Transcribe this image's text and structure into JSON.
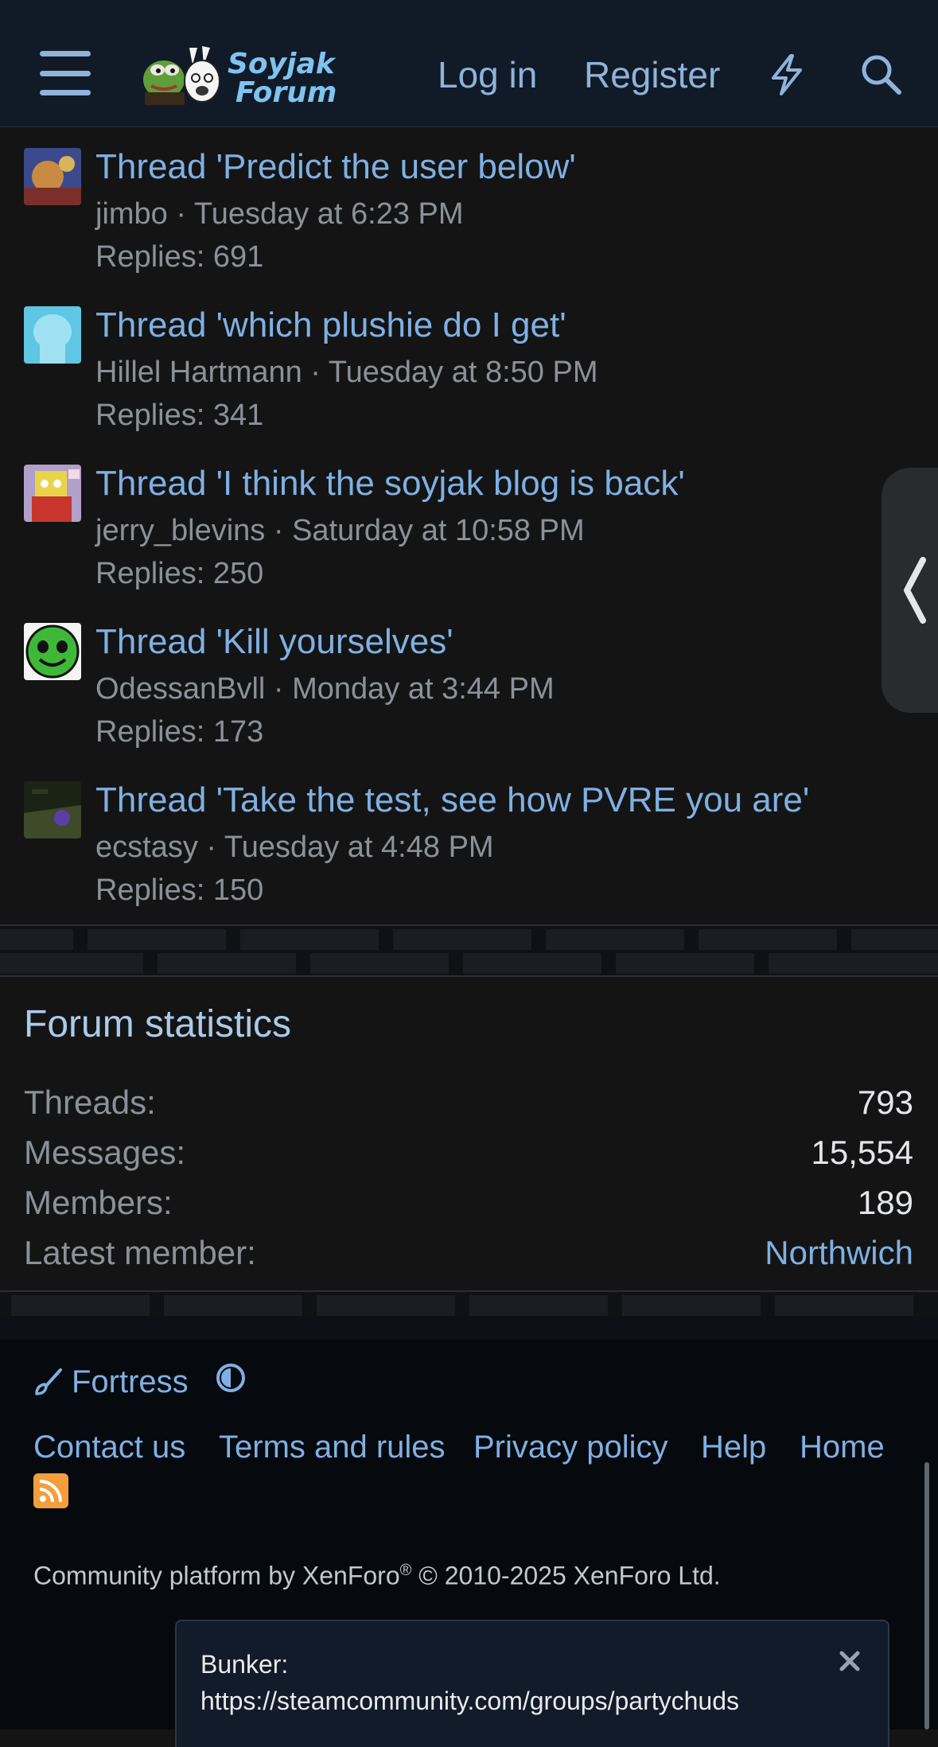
{
  "header": {
    "logo_text": "Soyjak Forum",
    "login_label": "Log in",
    "register_label": "Register"
  },
  "threads": [
    {
      "title": "Thread 'Predict the user below'",
      "meta": "jimbo · Tuesday at 6:23 PM",
      "replies": "Replies: 691"
    },
    {
      "title": "Thread 'which plushie do I get'",
      "meta": "Hillel Hartmann · Tuesday at 8:50 PM",
      "replies": "Replies: 341"
    },
    {
      "title": "Thread 'I think the soyjak blog is back'",
      "meta": "jerry_blevins · Saturday at 10:58 PM",
      "replies": "Replies: 250"
    },
    {
      "title": "Thread 'Kill yourselves'",
      "meta": "OdessanBvll · Monday at 3:44 PM",
      "replies": "Replies: 173"
    },
    {
      "title": "Thread 'Take the test, see how PVRE you are'",
      "meta": "ecstasy · Tuesday at 4:48 PM",
      "replies": "Replies: 150"
    }
  ],
  "stats": {
    "title": "Forum statistics",
    "rows": [
      {
        "label": "Threads:",
        "value": "793"
      },
      {
        "label": "Messages:",
        "value": "15,554"
      },
      {
        "label": "Members:",
        "value": "189"
      },
      {
        "label": "Latest member:",
        "value": "Northwich"
      }
    ]
  },
  "footer": {
    "style_label": "Fortress",
    "links": [
      "Contact us",
      "Terms and rules",
      "Privacy policy",
      "Help",
      "Home"
    ],
    "copyright_prefix": "Community platform by XenForo",
    "copyright_reg": "®",
    "copyright_suffix": " © 2010-2025 XenForo Ltd."
  },
  "notice": {
    "label": "Bunker:",
    "text": "https://steamcommunity.com/groups/partychuds"
  },
  "colors": {
    "header_bg": "#111a27",
    "link": "#7fb0e3",
    "body_bg": "#141414",
    "rss": "#f29e3d"
  }
}
